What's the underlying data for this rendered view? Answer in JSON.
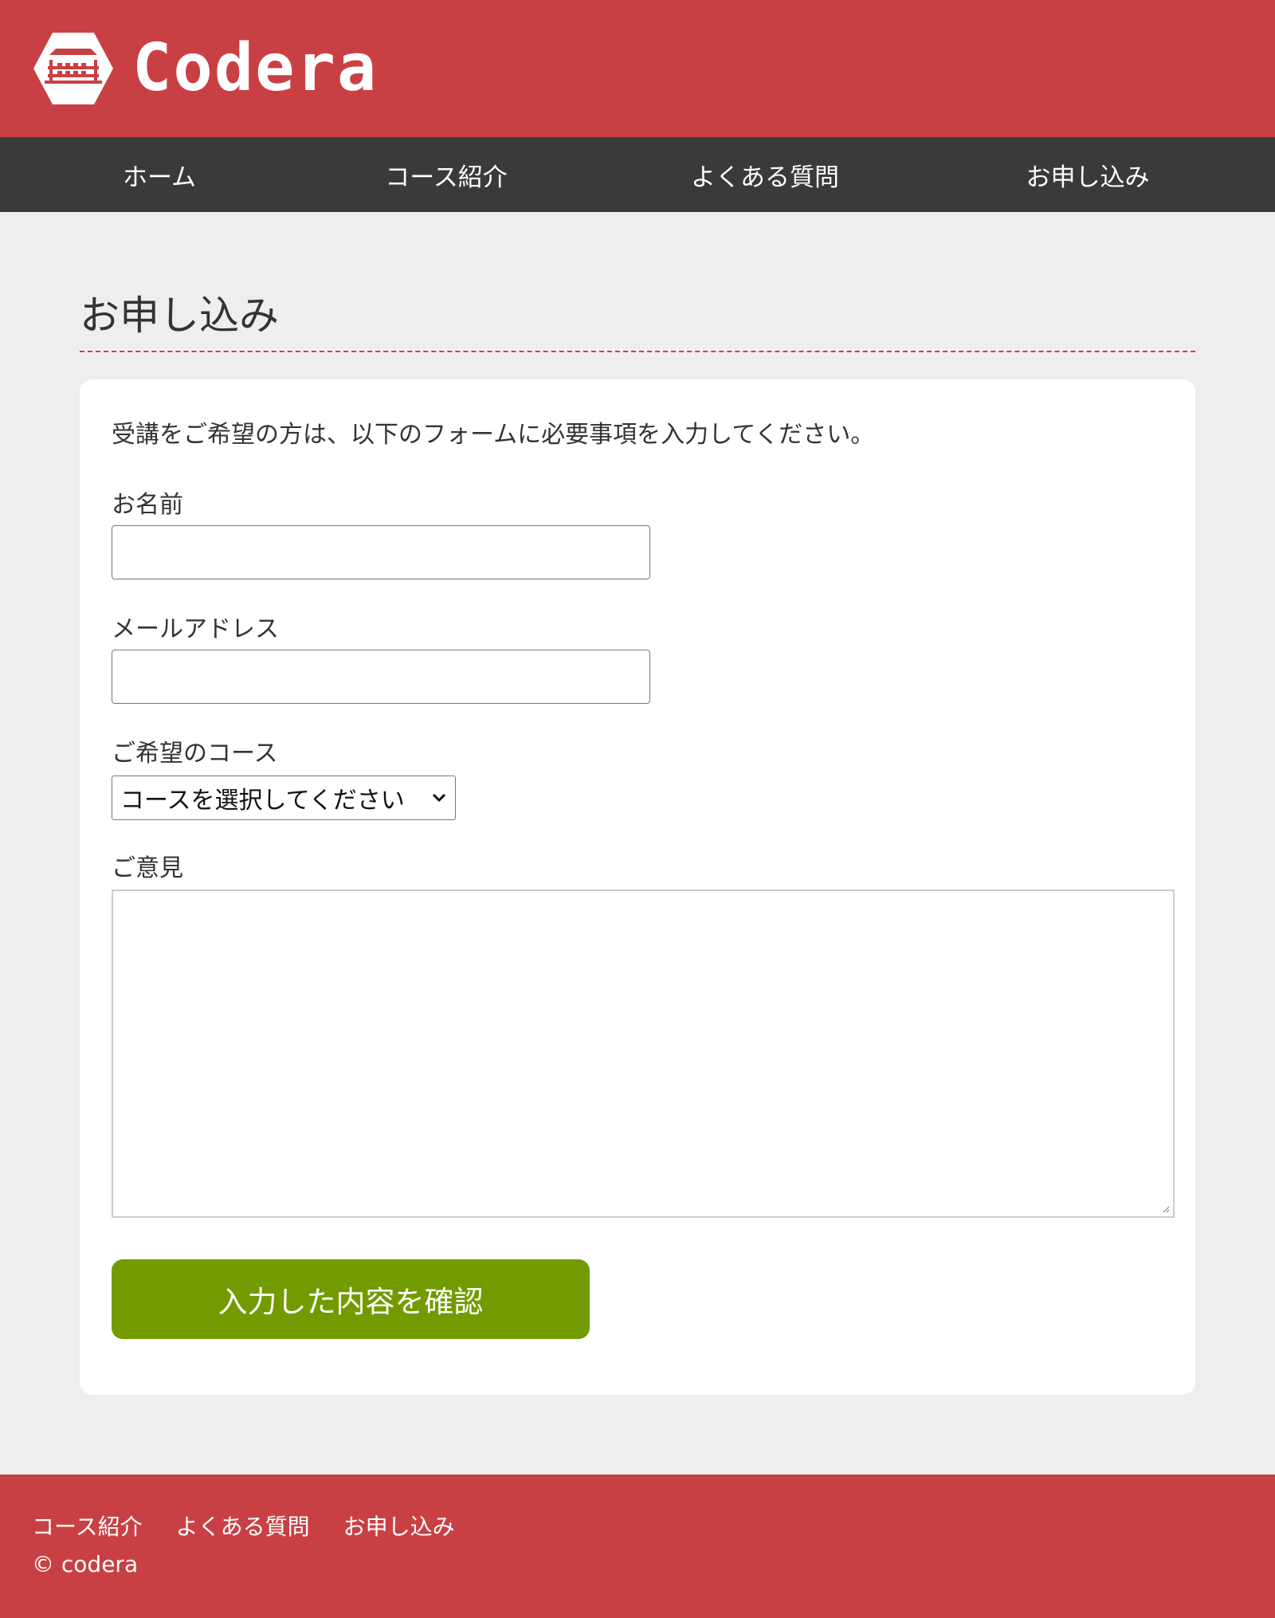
{
  "header": {
    "logo_text": "Codera"
  },
  "nav": {
    "items": [
      {
        "label": "ホーム"
      },
      {
        "label": "コース紹介"
      },
      {
        "label": "よくある質問"
      },
      {
        "label": "お申し込み"
      }
    ]
  },
  "main": {
    "page_title": "お申し込み",
    "intro": "受講をご希望の方は、以下のフォームに必要事項を入力してください。",
    "fields": {
      "name": {
        "label": "お名前",
        "value": ""
      },
      "email": {
        "label": "メールアドレス",
        "value": ""
      },
      "course": {
        "label": "ご希望のコース",
        "selected": "コースを選択してください"
      },
      "opinion": {
        "label": "ご意見",
        "value": ""
      }
    },
    "submit_label": "入力した内容を確認"
  },
  "footer": {
    "links": [
      {
        "label": "コース紹介"
      },
      {
        "label": "よくある質問"
      },
      {
        "label": "お申し込み"
      }
    ],
    "copyright": "© codera"
  },
  "colors": {
    "brand_red": "#c94044",
    "nav_dark": "#3a3a3a",
    "button_green": "#739b00",
    "page_bg": "#eeeeee"
  },
  "icons": {
    "logo": "building-hexagon-icon",
    "select_arrow": "chevron-down-icon",
    "textarea_resize": "resize-grip-icon"
  }
}
